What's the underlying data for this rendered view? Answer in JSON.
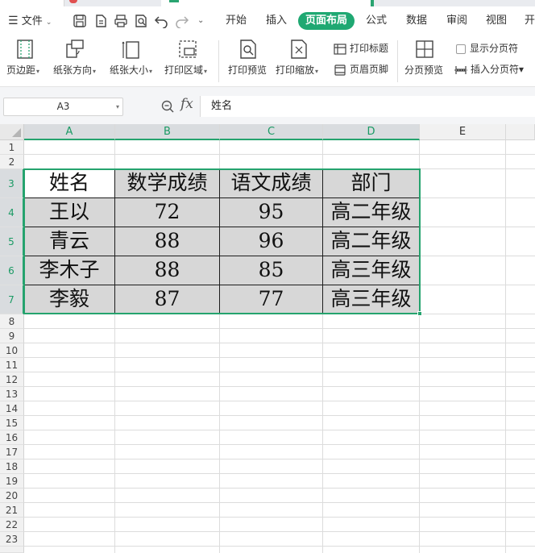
{
  "menubar": {
    "file_label": "文件",
    "tabs": [
      "开始",
      "插入",
      "页面布局",
      "公式",
      "数据",
      "审阅",
      "视图",
      "开"
    ],
    "active_tab": "页面布局"
  },
  "ribbon": {
    "margins": "页边距",
    "orientation": "纸张方向",
    "paper_size": "纸张大小",
    "print_area": "打印区域",
    "print_preview": "打印预览",
    "print_scale": "打印缩放",
    "print_titles": "打印标题",
    "header_footer": "页眉页脚",
    "page_break_preview": "分页预览",
    "show_page_breaks": "显示分页符",
    "insert_page_break": "插入分页符"
  },
  "formula_bar": {
    "cell_ref": "A3",
    "fx_label": "fx",
    "content": "姓名"
  },
  "grid": {
    "columns": [
      "A",
      "B",
      "C",
      "D",
      "E"
    ],
    "selected_columns": [
      "A",
      "B",
      "C",
      "D"
    ],
    "rows": [
      "1",
      "2",
      "3",
      "4",
      "5",
      "6",
      "7",
      "8",
      "9",
      "10",
      "11",
      "12",
      "13",
      "14",
      "15",
      "16",
      "17",
      "18",
      "19",
      "20",
      "21",
      "22",
      "23"
    ],
    "selected_rows": [
      "3",
      "4",
      "5",
      "6",
      "7"
    ]
  },
  "table": {
    "headers": [
      "姓名",
      "数学成绩",
      "语文成绩",
      "部门"
    ],
    "rows": [
      [
        "王以",
        "72",
        "95",
        "高二年级"
      ],
      [
        "青云",
        "88",
        "96",
        "高二年级"
      ],
      [
        "李木子",
        "88",
        "85",
        "高三年级"
      ],
      [
        "李毅",
        "87",
        "77",
        "高三年级"
      ]
    ]
  },
  "colors": {
    "accent_green": "#1fa872",
    "selected_fill": "#d7d7d7"
  }
}
